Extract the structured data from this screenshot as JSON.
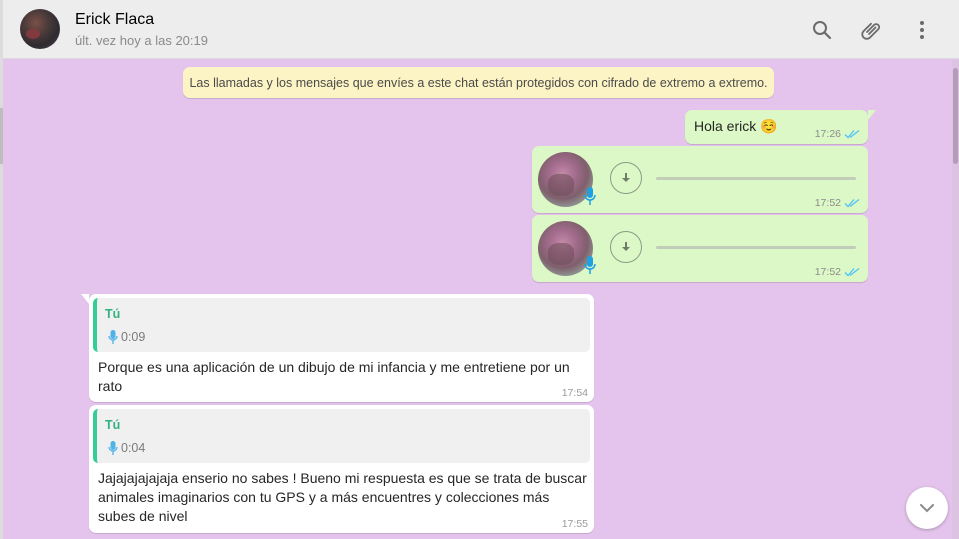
{
  "header": {
    "contact_name": "Erick Flaca",
    "contact_status": "últ. vez hoy a las 20:19",
    "icons": [
      "search-icon",
      "attach-icon",
      "menu-icon"
    ]
  },
  "encryption_notice": "Las llamadas y los mensajes que envíes a este chat están protegidos con cifrado de extremo a extremo.",
  "messages": [
    {
      "direction": "out",
      "type": "text",
      "text": "Hola erick",
      "emoji": "☺️",
      "time": "17:26",
      "status": "read"
    },
    {
      "direction": "out",
      "type": "voice",
      "time": "17:52",
      "status": "read"
    },
    {
      "direction": "out",
      "type": "voice",
      "time": "17:52",
      "status": "read"
    },
    {
      "direction": "in",
      "type": "reply",
      "quote_author": "Tú",
      "quote_duration": "0:09",
      "text": "Porque es una aplicación de un dibujo de mi infancia y me entretiene por un rato",
      "time": "17:54"
    },
    {
      "direction": "in",
      "type": "reply",
      "quote_author": "Tú",
      "quote_duration": "0:04",
      "text": "Jajajajajajaja enserio no sabes ! Bueno mi respuesta es que se trata de buscar animales imaginarios con tu GPS y a más encuentres y colecciones más subes de nivel",
      "time": "17:55"
    }
  ],
  "colors": {
    "chat_background": "#e4c3ec",
    "outgoing_bubble": "#dcf8c6",
    "incoming_bubble": "#ffffff",
    "read_ticks": "#4fc3f7",
    "quote_accent": "#35cd96",
    "notice_background": "#fdf4c5"
  }
}
